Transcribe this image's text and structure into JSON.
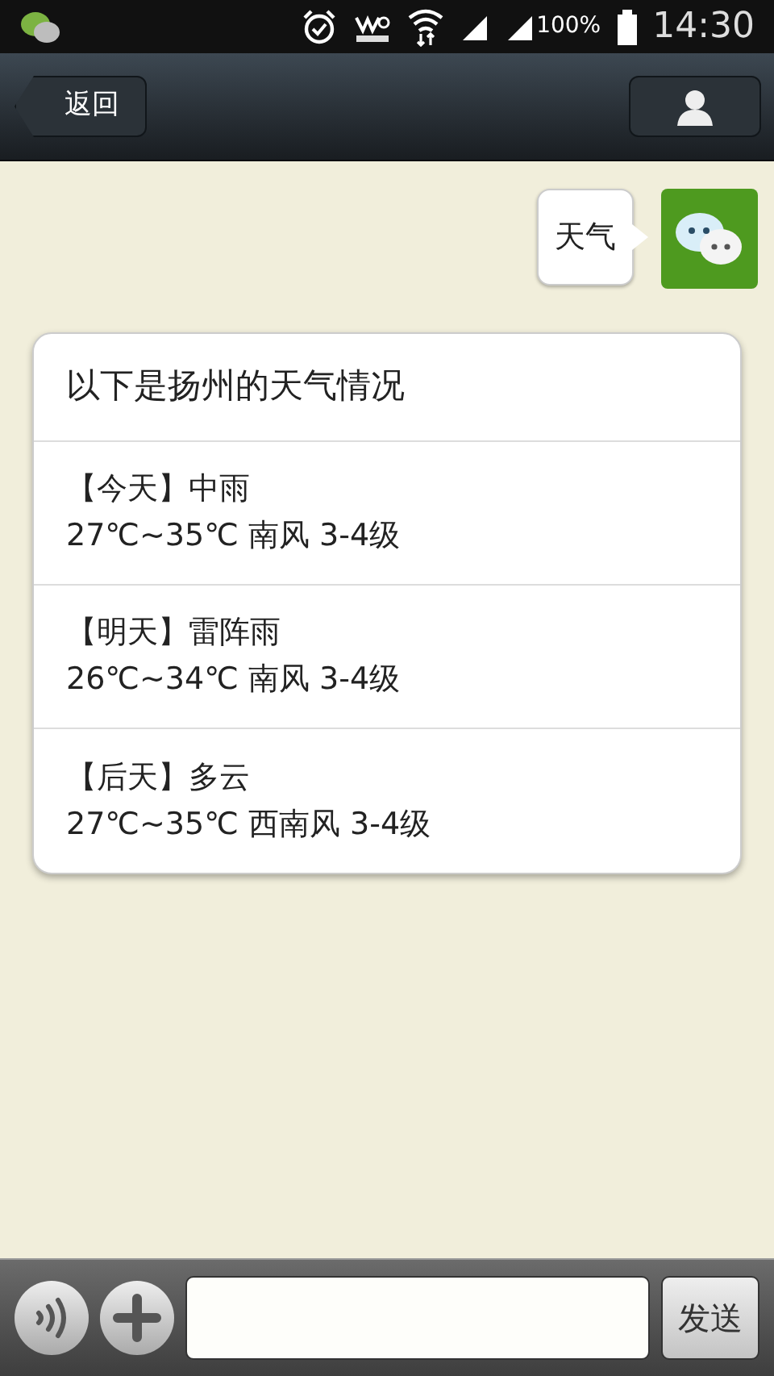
{
  "status_bar": {
    "battery_text": "100%",
    "time": "14:30"
  },
  "header": {
    "back_label": "返回"
  },
  "sent_message": {
    "text": "天气"
  },
  "weather_card": {
    "title": "以下是扬州的天气情况",
    "days": [
      {
        "label": "【今天】中雨",
        "detail": "27℃~35℃ 南风 3-4级"
      },
      {
        "label": "【明天】雷阵雨",
        "detail": "26℃~34℃ 南风 3-4级"
      },
      {
        "label": "【后天】多云",
        "detail": "27℃~35℃ 西南风 3-4级"
      }
    ]
  },
  "input_bar": {
    "send_label": "发送"
  }
}
